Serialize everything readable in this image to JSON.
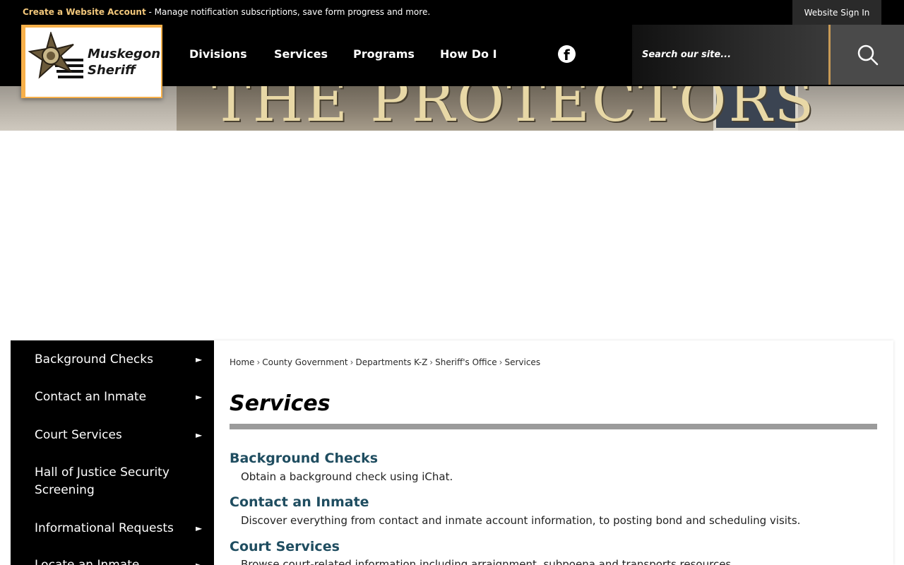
{
  "topbar": {
    "create_label": "Create a Website Account",
    "notice_text": " - Manage notification subscriptions, save form progress and more.",
    "signin_label": "Website Sign In"
  },
  "logo": {
    "line1": "Muskegon",
    "line2": "Sheriff"
  },
  "nav": [
    "Divisions",
    "Services",
    "Programs",
    "How Do I"
  ],
  "search": {
    "placeholder": "Search our site..."
  },
  "banner": {
    "sign_text": "THE PROTECTORS"
  },
  "sidebar": {
    "items": [
      {
        "label": "Background Checks",
        "arrow": "►"
      },
      {
        "label": "Contact an Inmate",
        "arrow": "►"
      },
      {
        "label": "Court Services",
        "arrow": "►"
      },
      {
        "label": "Hall of Justice Security Screening",
        "arrow": ""
      },
      {
        "label": "Informational Requests",
        "arrow": "►"
      },
      {
        "label": "Locate an Inmate",
        "arrow": "►"
      }
    ]
  },
  "breadcrumb": [
    "Home",
    "County Government",
    "Departments K-Z",
    "Sheriff's Office",
    "Services"
  ],
  "breadcrumb_sep": "›",
  "page": {
    "title": "Services"
  },
  "services": [
    {
      "title": "Background Checks",
      "desc": "Obtain a background check using iChat."
    },
    {
      "title": "Contact an Inmate",
      "desc": "Discover everything from contact and inmate account information, to posting bond and scheduling visits."
    },
    {
      "title": "Court Services",
      "desc": "Browse court-related information including arraignment, subpoena and transports resources."
    }
  ],
  "colors": {
    "accent": "#f2c77b",
    "link": "#1f4d60",
    "logo_border": "#f7b04a"
  },
  "icons": {
    "social": "facebook-icon",
    "search": "search-icon",
    "arrow": "arrow-right-icon"
  }
}
